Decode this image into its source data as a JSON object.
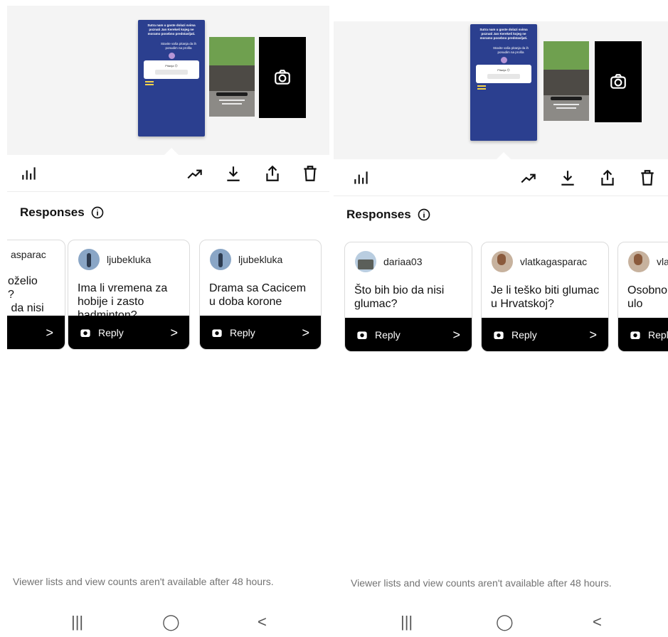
{
  "colors": {
    "story_bg": "#2b3f8f",
    "reply_bar": "#000000",
    "note_text": "#737373"
  },
  "icons": [
    "insights-icon",
    "trending-icon",
    "download-icon",
    "share-icon",
    "delete-icon",
    "info-icon",
    "camera-icon"
  ],
  "left": {
    "responses_title": "Responses",
    "cards": [
      {
        "username": "asparac",
        "question": "oželio\n?\n da nisi\n ?",
        "reply_label": ""
      },
      {
        "username": "ljubekluka",
        "question": "Ima li vremena za hobije i zasto badminton?",
        "reply_label": "Reply"
      },
      {
        "username": "ljubekluka",
        "question": "Drama sa Cacicem u doba korone",
        "reply_label": "Reply"
      }
    ],
    "footer_note": "Viewer lists and view counts aren't available after 48 hours."
  },
  "right": {
    "responses_title": "Responses",
    "cards": [
      {
        "username": "dariaa03",
        "question": "Što bih bio da nisi glumac?",
        "reply_label": "Reply"
      },
      {
        "username": "vlatkagasparac",
        "question": "Je li teško biti glumac u Hrvatskoj?",
        "reply_label": "Reply"
      },
      {
        "username": "vla",
        "question": "Osobno predsta imao ulo",
        "reply_label": "Reply"
      }
    ],
    "footer_note": "Viewer lists and view counts aren't available after 48 hours."
  },
  "story": {
    "line1": "Sutra nam u goste dolazi svima poznati Jan Kerekeš kojeg ne moramo posebno predstavljati.",
    "line2": "Stavite vaša pitanja da ih ponudim na prošla",
    "poll_label": "Pitanja 😊"
  },
  "navbar": {
    "recent": "|||",
    "home": "◯",
    "back": "<"
  }
}
